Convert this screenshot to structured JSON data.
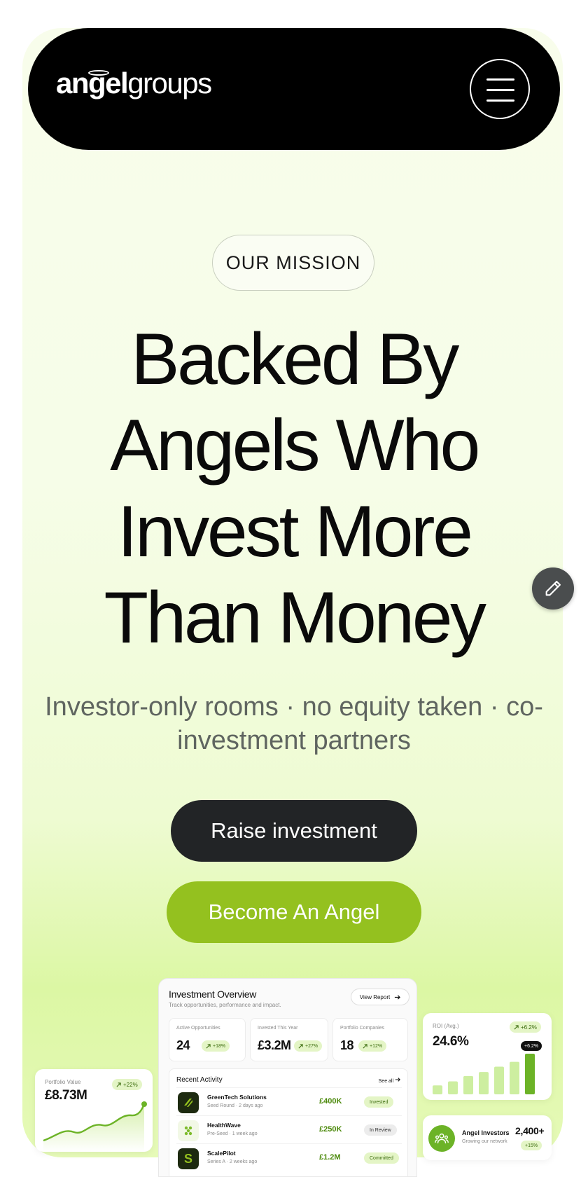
{
  "header": {
    "logo_bold": "angel",
    "logo_light": "groups"
  },
  "hero": {
    "eyebrow": "OUR MISSION",
    "headline": [
      "Backed By",
      "Angels Who",
      "Invest More",
      "Than Money"
    ],
    "subline": "Investor-only rooms · no equity taken · co-investment partners",
    "primary_cta": "Raise investment",
    "secondary_cta": "Become An Angel"
  },
  "dashboard": {
    "title": "Investment Overview",
    "subtitle": "Track opportunities, performance and impact.",
    "view_report": "View Report",
    "stats": [
      {
        "label": "Active Opportunities",
        "value": "24",
        "change": "+18%"
      },
      {
        "label": "Invested This Year",
        "value": "£3.2M",
        "change": "+27%"
      },
      {
        "label": "Portfolio Companies",
        "value": "18",
        "change": "+12%"
      }
    ],
    "activity_title": "Recent Activity",
    "see_all": "See all",
    "activity": [
      {
        "name": "GreenTech Solutions",
        "meta": "Seed Round · 2 days ago",
        "amount": "£400K",
        "status": "Invested"
      },
      {
        "name": "HealthWave",
        "meta": "Pre-Seed · 1 week ago",
        "amount": "£250K",
        "status": "In Review"
      },
      {
        "name": "ScalePilot",
        "meta": "Series A · 2 weeks ago",
        "amount": "£1.2M",
        "status": "Committed"
      }
    ]
  },
  "portfolio_card": {
    "label": "Portfolio Value",
    "value": "£8.73M",
    "change": "+22%"
  },
  "roi_card": {
    "label": "ROI (Avg.)",
    "value": "24.6%",
    "change": "+6.2%",
    "tooltip": "+6.2%",
    "bars": [
      0.22,
      0.32,
      0.45,
      0.55,
      0.68,
      0.8,
      1.0
    ]
  },
  "investors_card": {
    "label": "Angel Investors",
    "meta": "Growing our network",
    "value": "2,400+",
    "change": "+15%"
  },
  "colors": {
    "accent": "#94c11f",
    "dark": "#222426",
    "nav": "#000000"
  },
  "icons": [
    "menu-icon",
    "pencil-icon",
    "arrow-up-right-icon",
    "arrow-right-icon",
    "people-icon"
  ]
}
